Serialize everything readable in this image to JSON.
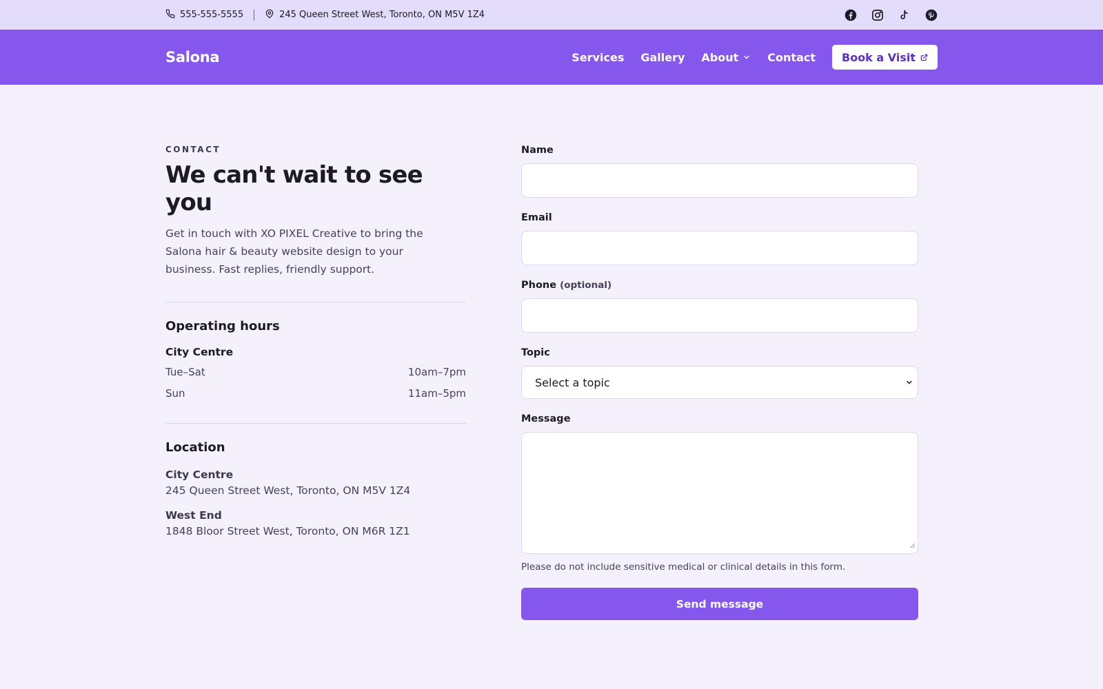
{
  "topbar": {
    "phone": "555-555-5555",
    "address": "245 Queen Street West, Toronto, ON M5V 1Z4",
    "social": [
      "facebook-icon",
      "instagram-icon",
      "tiktok-icon",
      "pinterest-icon"
    ]
  },
  "header": {
    "brand": "Salona",
    "nav": {
      "services": "Services",
      "gallery": "Gallery",
      "about": "About",
      "contact": "Contact"
    },
    "cta": "Book a Visit"
  },
  "contact": {
    "eyebrow": "CONTACT",
    "title": "We can't wait to see you",
    "intro": "Get in touch with XO PIXEL Creative to bring the Salona hair & beauty website design to your business. Fast replies, friendly support.",
    "hours": {
      "title": "Operating hours",
      "location": "City Centre",
      "rows": [
        {
          "days": "Tue–Sat",
          "time": "10am–7pm"
        },
        {
          "days": "Sun",
          "time": "11am–5pm"
        }
      ]
    },
    "locations": {
      "title": "Location",
      "items": [
        {
          "name": "City Centre",
          "address": "245 Queen Street West, Toronto, ON M5V 1Z4"
        },
        {
          "name": "West End",
          "address": "1848 Bloor Street West, Toronto, ON M6R 1Z1"
        }
      ]
    }
  },
  "form": {
    "name_label": "Name",
    "email_label": "Email",
    "phone_label": "Phone",
    "phone_optional": "(optional)",
    "topic_label": "Topic",
    "topic_value": "Select a topic",
    "message_label": "Message",
    "help": "Please do not include sensitive medical or clinical details in this form.",
    "submit": "Send message"
  },
  "colors": {
    "topbar_bg": "#e4dcfb",
    "nav_bg": "#8557ec",
    "page_bg": "#f4f1fd",
    "accent_text": "#5b30c6"
  }
}
